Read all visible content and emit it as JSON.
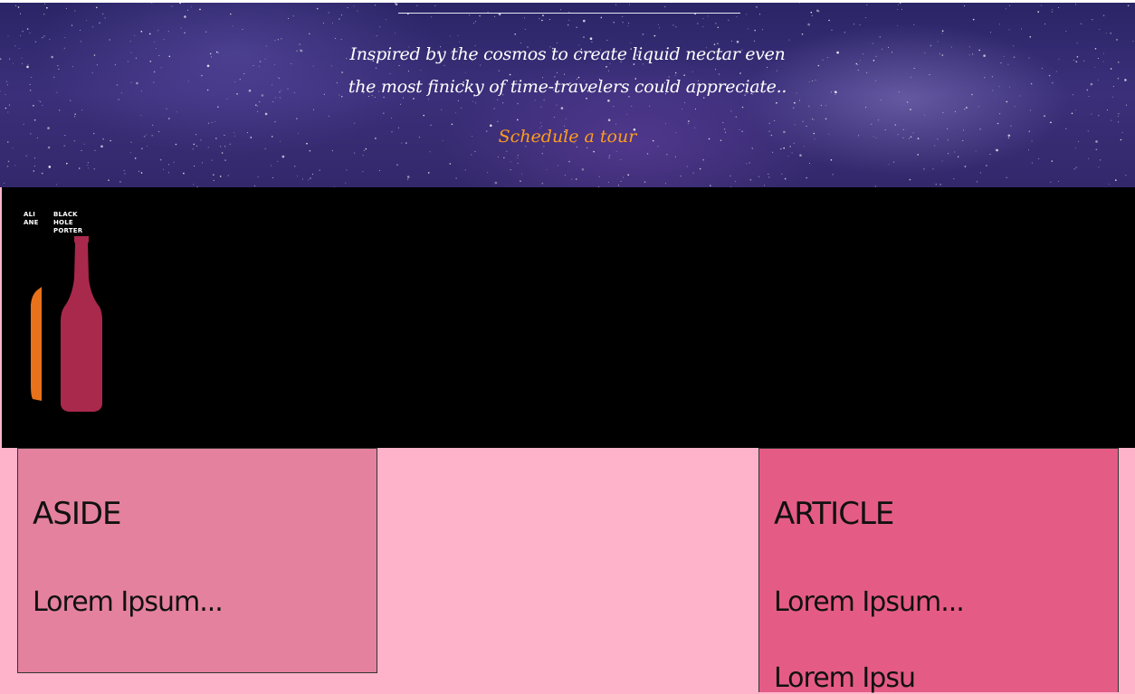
{
  "hero": {
    "tagline_line1": "Inspired by the cosmos to create liquid nectar even",
    "tagline_line2": "the most finicky of time-travelers could appreciate..",
    "cta_label": "Schedule a tour"
  },
  "products": {
    "bottles": [
      {
        "label_line1": "ALI",
        "label_line2": "ANE",
        "color": "#e8721c"
      },
      {
        "label_line1": "BLACK",
        "label_line2": "HOLE",
        "label_line3": "PORTER",
        "color": "#a8294b"
      }
    ]
  },
  "aside": {
    "heading": "ASIDE",
    "paragraphs": [
      "Lorem Ipsum..."
    ]
  },
  "article": {
    "heading": "ARTICLE",
    "paragraphs": [
      "Lorem Ipsum...",
      "Lorem Ipsu"
    ]
  },
  "colors": {
    "page_bg": "#ffb3cb",
    "aside_bg": "#e4819e",
    "article_bg": "#e45c85",
    "cta": "#ff9d1c",
    "band_bg": "#000000"
  }
}
